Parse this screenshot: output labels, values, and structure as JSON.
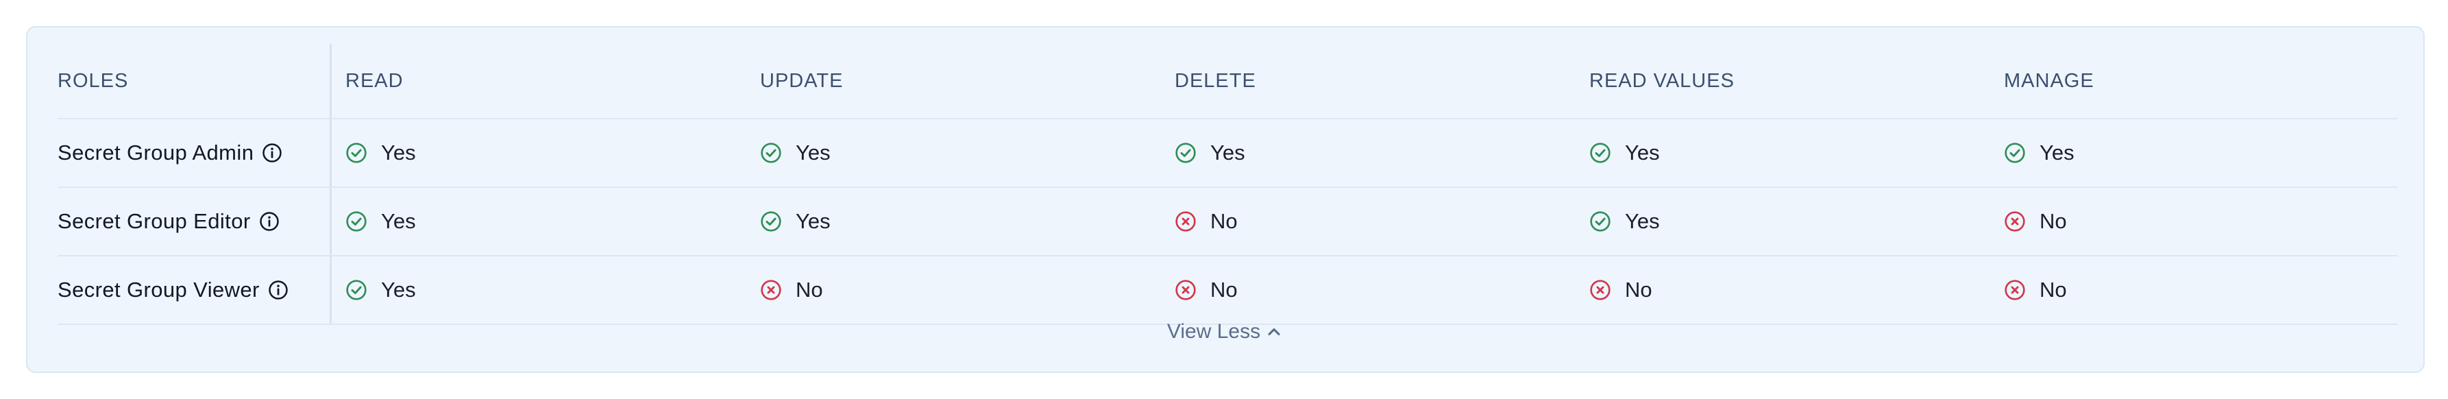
{
  "table": {
    "columns": [
      "ROLES",
      "READ",
      "UPDATE",
      "DELETE",
      "READ VALUES",
      "MANAGE"
    ],
    "rows": [
      {
        "role": "Secret Group Admin",
        "values": [
          "Yes",
          "Yes",
          "Yes",
          "Yes",
          "Yes"
        ]
      },
      {
        "role": "Secret Group Editor",
        "values": [
          "Yes",
          "Yes",
          "No",
          "Yes",
          "No"
        ]
      },
      {
        "role": "Secret Group Viewer",
        "values": [
          "Yes",
          "No",
          "No",
          "No",
          "No"
        ]
      }
    ]
  },
  "footer": {
    "toggle_label": "View Less",
    "toggle_icon": "chevron-up-icon"
  },
  "icons": {
    "yes": "check-circle-icon",
    "no": "x-circle-icon",
    "info": "info-icon"
  },
  "colors": {
    "card_bg": "#eff5fd",
    "card_border": "#dbe6f5",
    "yes": "#2f8f57",
    "no": "#d0394a",
    "header_text": "#3b4f6e",
    "link_text": "#5a6e8c"
  }
}
